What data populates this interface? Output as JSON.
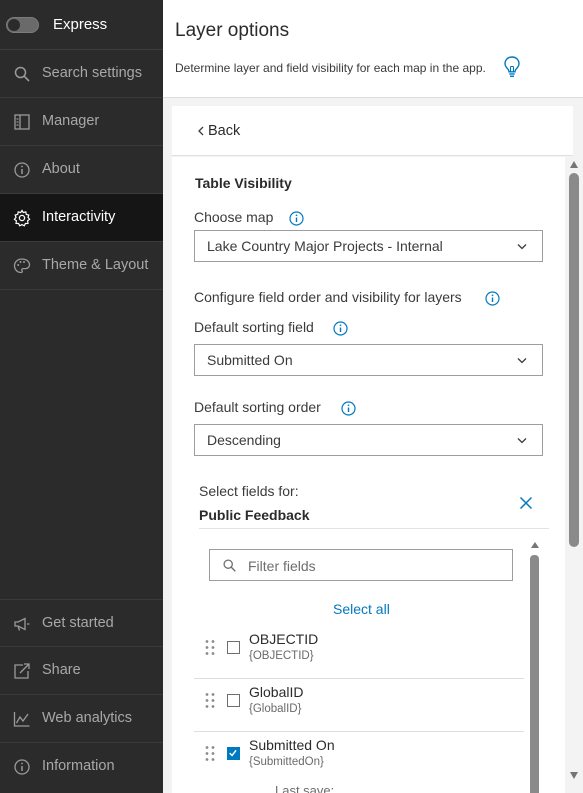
{
  "sidebar": {
    "express_label": "Express",
    "items": [
      {
        "label": "Search settings",
        "icon": "search-icon"
      },
      {
        "label": "Manager",
        "icon": "manager-icon"
      },
      {
        "label": "About",
        "icon": "info-icon"
      },
      {
        "label": "Interactivity",
        "icon": "gear-icon",
        "active": true
      },
      {
        "label": "Theme & Layout",
        "icon": "palette-icon"
      }
    ],
    "bottom_items": [
      {
        "label": "Get started",
        "icon": "megaphone-icon"
      },
      {
        "label": "Share",
        "icon": "share-icon"
      },
      {
        "label": "Web analytics",
        "icon": "analytics-icon"
      },
      {
        "label": "Information",
        "icon": "info-icon"
      }
    ]
  },
  "header": {
    "title": "Layer options",
    "description": "Determine layer and field visibility for each map in the app."
  },
  "back": {
    "label": "Back"
  },
  "form": {
    "section_title": "Table Visibility",
    "choose_map": {
      "label": "Choose map",
      "value": "Lake Country Major Projects - Internal"
    },
    "configure_label": "Configure field order and visibility for layers",
    "sorting_field": {
      "label": "Default sorting field",
      "value": "Submitted On"
    },
    "sorting_order": {
      "label": "Default sorting order",
      "value": "Descending"
    },
    "fields_panel": {
      "select_label": "Select fields for:",
      "layer_name": "Public Feedback",
      "filter_placeholder": "Filter fields",
      "select_all": "Select all",
      "fields": [
        {
          "name": "OBJECTID",
          "key": "{OBJECTID}",
          "checked": false
        },
        {
          "name": "GlobalID",
          "key": "{GlobalID}",
          "checked": false
        },
        {
          "name": "Submitted On",
          "key": "{SubmittedOn}",
          "checked": true
        }
      ]
    }
  },
  "footer": {
    "last_save": "Last save:"
  },
  "colors": {
    "accent": "#0079c1",
    "sidebar_bg": "#2b2b2b",
    "sidebar_active": "#151515"
  }
}
